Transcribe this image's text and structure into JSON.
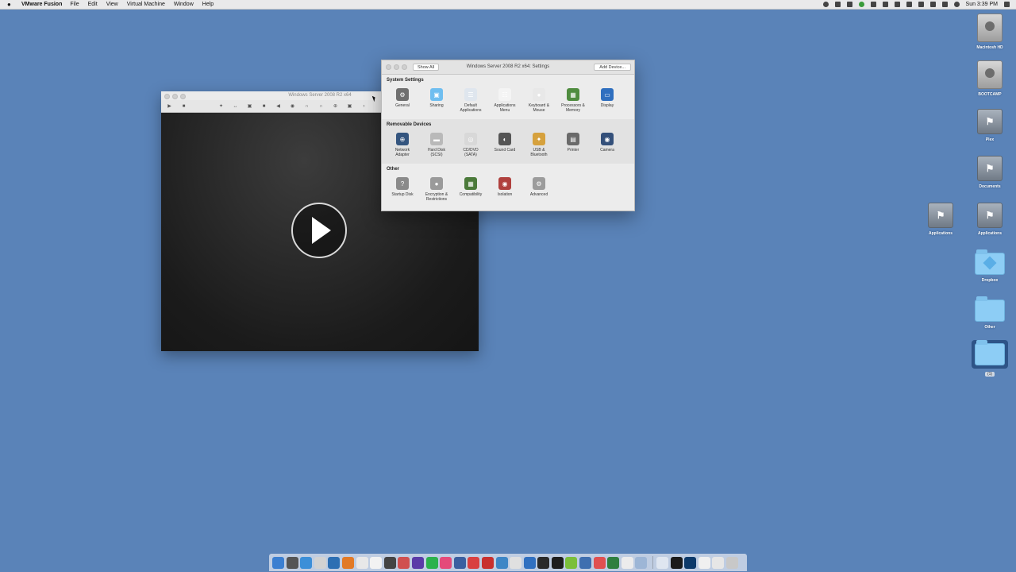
{
  "menubar": {
    "apple": "",
    "app_name": "VMware Fusion",
    "items": [
      "File",
      "Edit",
      "View",
      "Virtual Machine",
      "Window",
      "Help"
    ],
    "clock": "Sun 3:39 PM"
  },
  "desktop_icons": [
    {
      "label": "Macintosh HD",
      "icon": "hard-drive-icon"
    },
    {
      "label": "BOOTCAMP",
      "icon": "hard-drive-icon"
    },
    {
      "label": "Plex",
      "icon": "network-share-icon"
    },
    {
      "label": "Documents",
      "icon": "network-share-icon"
    },
    {
      "label": "Applications",
      "icon": "network-share-icon"
    },
    {
      "label": "Applications",
      "icon": "network-share-icon"
    },
    {
      "label": "Dropbox",
      "icon": "dropbox-folder-icon"
    },
    {
      "label": "Other",
      "icon": "folder-icon"
    },
    {
      "label": "(1)",
      "icon": "folder-icon"
    }
  ],
  "vm_window": {
    "title": "Windows Server 2008 R2 x64"
  },
  "settings": {
    "title": "Windows Server 2008 R2 x64: Settings",
    "show_all": "Show All",
    "add_device": "Add Device...",
    "sections": [
      {
        "heading": "System Settings",
        "items": [
          {
            "label": "General",
            "icon": "general-icon",
            "color": "#6f6f6f"
          },
          {
            "label": "Sharing",
            "icon": "sharing-folder-icon",
            "color": "#6fbef0"
          },
          {
            "label": "Default\nApplications",
            "icon": "default-applications-icon",
            "color": "#dfe6ee"
          },
          {
            "label": "Applications\nMenu",
            "icon": "applications-menu-icon",
            "color": "#f4f4f4"
          },
          {
            "label": "Keyboard &\nMouse",
            "icon": "keyboard-mouse-icon",
            "color": "#e8e8e8"
          },
          {
            "label": "Processors &\nMemory",
            "icon": "processor-icon",
            "color": "#4f8c3f"
          },
          {
            "label": "Display",
            "icon": "display-icon",
            "color": "#2f6fbf"
          }
        ]
      },
      {
        "heading": "Removable Devices",
        "items": [
          {
            "label": "Network\nAdapter",
            "icon": "network-adapter-icon",
            "color": "#34557f"
          },
          {
            "label": "Hard Disk\n(SCSI)",
            "icon": "hard-disk-icon",
            "color": "#b9b9b9"
          },
          {
            "label": "CD/DVD\n(SATA)",
            "icon": "cd-dvd-icon",
            "color": "#d8d8d8"
          },
          {
            "label": "Sound Card",
            "icon": "sound-card-icon",
            "color": "#555555"
          },
          {
            "label": "USB &\nBluetooth",
            "icon": "usb-bluetooth-icon",
            "color": "#d6a13d"
          },
          {
            "label": "Printer",
            "icon": "printer-icon",
            "color": "#6a6a6a"
          },
          {
            "label": "Camera",
            "icon": "camera-icon",
            "color": "#34507a"
          }
        ]
      },
      {
        "heading": "Other",
        "items": [
          {
            "label": "Startup Disk",
            "icon": "startup-disk-icon",
            "color": "#8a8a8a"
          },
          {
            "label": "Encryption &\nRestrictions",
            "icon": "encryption-lock-icon",
            "color": "#9a9a9a"
          },
          {
            "label": "Compatibility",
            "icon": "compatibility-icon",
            "color": "#4b7a3a"
          },
          {
            "label": "Isolation",
            "icon": "isolation-icon",
            "color": "#b0413e"
          },
          {
            "label": "Advanced",
            "icon": "advanced-gear-icon",
            "color": "#9c9c9c"
          }
        ]
      }
    ]
  },
  "dock_colors": [
    "#3b7fd1",
    "#555555",
    "#3c8fd8",
    "#d2d2d2",
    "#2d6fb3",
    "#e27a26",
    "#e8e8e8",
    "#f2f2f2",
    "#444444",
    "#d05050",
    "#5a3aa8",
    "#2bb24c",
    "#e44a7a",
    "#3a5fa0",
    "#d94040",
    "#c8302e",
    "#3d86c6",
    "#e0e0e0",
    "#3070c0",
    "#2a2a2a",
    "#1e1e1e",
    "#7bbf3a",
    "#3f6fb0",
    "#e05050",
    "#2f7f3f",
    "#ececec",
    "#9db6d6",
    "#dfe6f0",
    "#1b1b1b",
    "#0d3a6a",
    "#f0f0f0",
    "#e6e6e6",
    "#c8c8c8"
  ]
}
